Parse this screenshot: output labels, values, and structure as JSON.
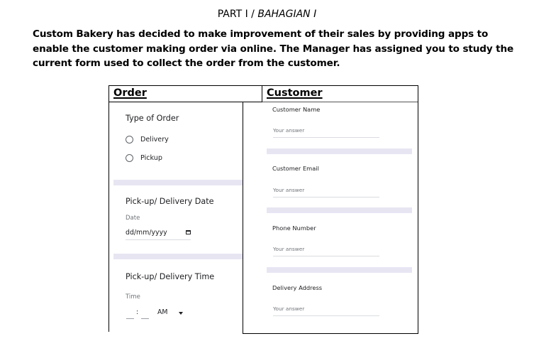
{
  "heading": {
    "part": "PART I / ",
    "part_italic": "BAHAGIAN I"
  },
  "intro_text": "Custom Bakery has decided to make improvement of their sales by providing apps to enable the customer making order via online. The Manager has assigned you to study the current form used to collect the order from the customer.",
  "table": {
    "order_header": "Order",
    "customer_header": "Customer"
  },
  "order_form": {
    "type_of_order": {
      "title": "Type of Order",
      "options": [
        "Delivery",
        "Pickup"
      ]
    },
    "date_question": {
      "title": "Pick-up/ Delivery Date",
      "label": "Date",
      "placeholder": "dd/mm/yyyy"
    },
    "time_question": {
      "title": "Pick-up/ Delivery Time",
      "label": "Time",
      "separator": ":",
      "ampm": "AM"
    }
  },
  "customer_form": {
    "fields": [
      {
        "label": "Customer Name",
        "placeholder": "Your answer"
      },
      {
        "label": "Customer Email",
        "placeholder": "Your answer"
      },
      {
        "label": "Phone Number",
        "placeholder": "Your answer"
      },
      {
        "label": "Delivery Address",
        "placeholder": "Your answer"
      }
    ]
  },
  "colors": {
    "divider": "#e8e5f3",
    "text": "#202124",
    "muted": "#70757a"
  }
}
